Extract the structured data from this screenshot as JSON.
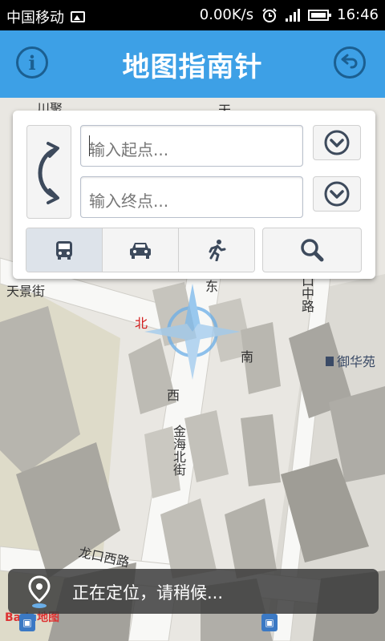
{
  "status_bar": {
    "carrier": "中国移动",
    "speed": "0.00K/s",
    "time": "16:46"
  },
  "app_bar": {
    "title": "地图指南针",
    "info_icon_glyph": "i",
    "colors": {
      "bar": "#3da0e6",
      "icon": "#1b5f91"
    }
  },
  "search_panel": {
    "start_placeholder": "输入起点...",
    "end_placeholder": "输入终点...",
    "modes": [
      {
        "name": "bus",
        "icon": "bus-icon",
        "active": true
      },
      {
        "name": "car",
        "icon": "car-icon",
        "active": false
      },
      {
        "name": "walk",
        "icon": "walk-icon",
        "active": false
      }
    ],
    "search_icon": "search-icon"
  },
  "map": {
    "labels": {
      "chuanju": "川聚",
      "tian_top": "天",
      "tianjing_street": "天景街",
      "dong": "东",
      "nan": "南",
      "xi": "西",
      "north_marker": "北",
      "longkou_middle_road": "口中路",
      "yuhuayuan": "御华苑",
      "jinhai_north_street": "金海北街",
      "longkou_west_road": "龙口西路"
    },
    "logo": {
      "prefix": "Ba",
      "mid": "du",
      "suffix": "地图"
    }
  },
  "toast": {
    "message": "正在定位，请稍候..."
  }
}
